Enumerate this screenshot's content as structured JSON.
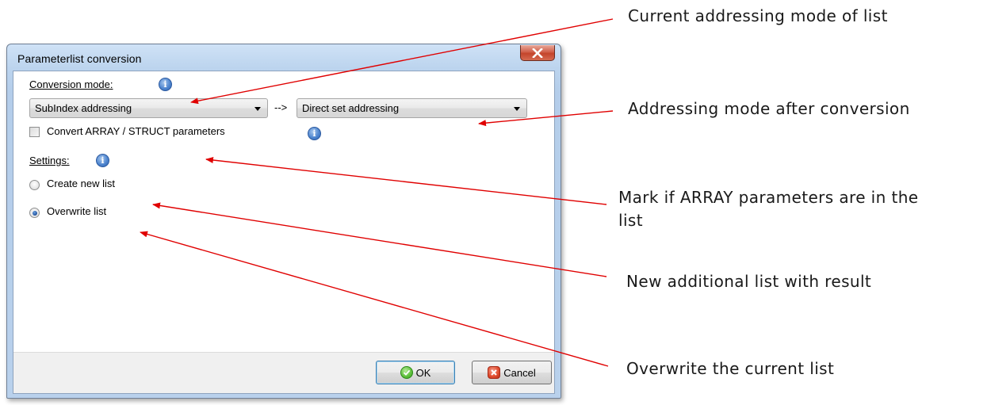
{
  "dialog": {
    "title": "Parameterlist conversion",
    "close_label": "x",
    "conversion_mode_label": "Conversion mode:",
    "info_glyph": "i",
    "source_mode": "SubIndex addressing",
    "arrow_text": "-->",
    "target_mode": "Direct set addressing",
    "convert_checkbox_label": "Convert ARRAY / STRUCT parameters",
    "convert_checked": false,
    "settings_label": "Settings:",
    "radio_create_label": "Create new list",
    "radio_overwrite_label": "Overwrite list",
    "selected_setting": "Overwrite list",
    "ok_label": "OK",
    "cancel_label": "Cancel"
  },
  "annotations": {
    "current_mode": "Current addressing mode of list",
    "after_mode": "Addressing mode after conversion",
    "mark_array_line1": "Mark if ARRAY parameters are in the",
    "mark_array_line2": "list",
    "new_list": "New additional list with result",
    "overwrite": "Overwrite the current list"
  },
  "colors": {
    "arrow": "#e00000",
    "title_bar": "#b9d1ec",
    "close_button": "#c4442b"
  },
  "icons": [
    "close-icon",
    "info-icon",
    "chevron-down-icon",
    "ok-check-icon",
    "cancel-x-icon"
  ]
}
